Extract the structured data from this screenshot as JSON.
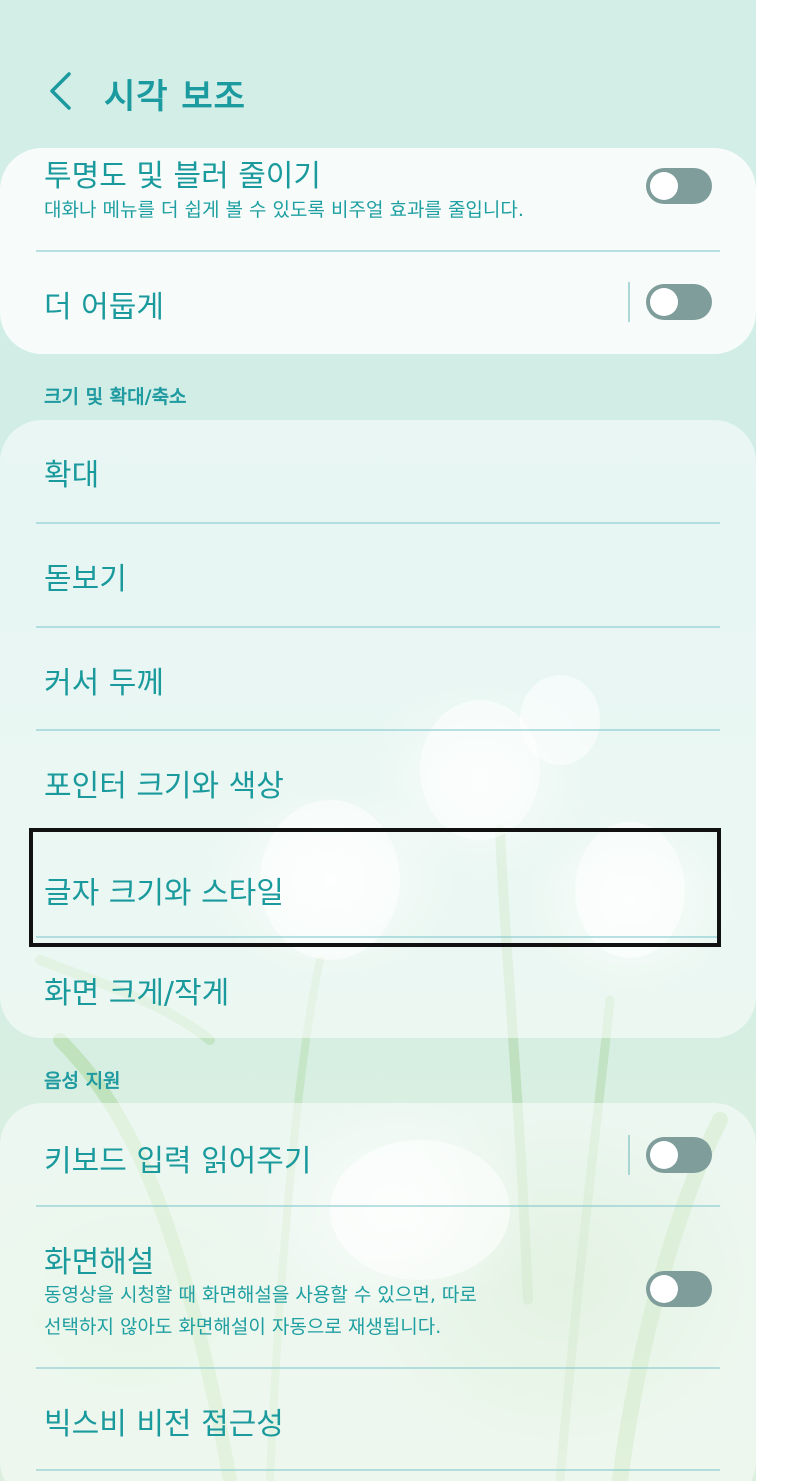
{
  "header": {
    "back_icon": "chevron-left-icon",
    "title": "시각 보조"
  },
  "card1": {
    "reduce_transparency": {
      "title": "투명도 및 블러 줄이기",
      "subtitle": "대화나 메뉴를 더 쉽게 볼 수 있도록 비주얼 효과를 줄입니다.",
      "toggle_state": "off"
    },
    "darker": {
      "title": "더 어둡게",
      "toggle_state": "off"
    }
  },
  "section_size": "크기 및 확대/축소",
  "card2": {
    "magnification": "확대",
    "magnifier": "돋보기",
    "cursor_thickness": "커서 두께",
    "pointer_size_color": "포인터 크기와 색상",
    "font_size_style": "글자 크기와 스타일",
    "screen_zoom": "화면 크게/작게"
  },
  "section_voice": "음성 지원",
  "card3": {
    "keyboard_read": {
      "title": "키보드 입력 읽어주기",
      "toggle_state": "off"
    },
    "audio_description": {
      "title": "화면해설",
      "subtitle": "동영상을 시청할 때 화면해설을 사용할 수 있으면, 따로\n선택하지 않아도 화면해설이 자동으로 재생됩니다.",
      "toggle_state": "off"
    },
    "bixby_vision": "빅스비 비전 접근성"
  },
  "colors": {
    "accent": "#1a9a9c",
    "toggle_off": "#7f9d9b",
    "highlight_border": "#111111"
  }
}
